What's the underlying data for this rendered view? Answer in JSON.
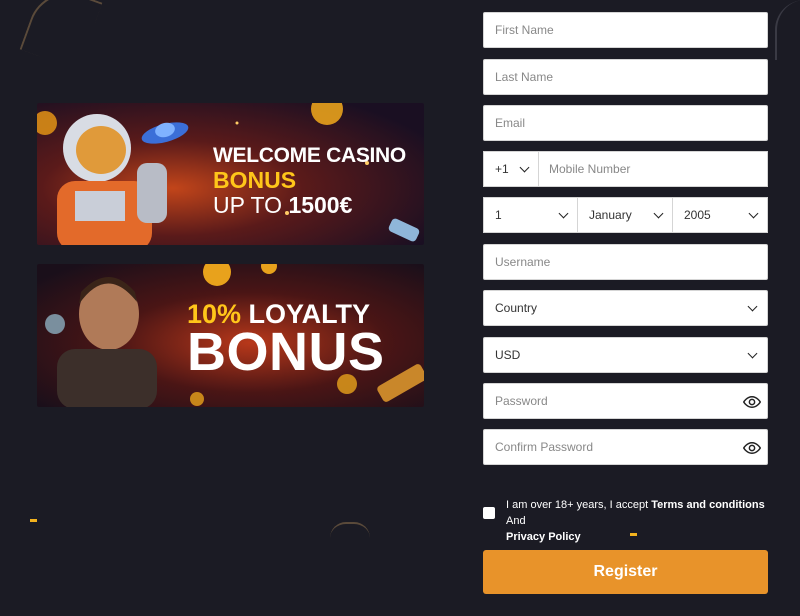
{
  "banners": {
    "welcome": {
      "line1": "WELCOME CASINO",
      "line2": "BONUS",
      "line3_prefix": "UP TO ",
      "line3_amount": "1500€"
    },
    "loyalty": {
      "percent": "10%",
      "line1_rest": " LOYALTY",
      "line2": "BONUS"
    }
  },
  "form": {
    "first_name": {
      "placeholder": "First Name"
    },
    "last_name": {
      "placeholder": "Last Name"
    },
    "email": {
      "placeholder": "Email"
    },
    "phone": {
      "code": "+1",
      "placeholder": "Mobile Number"
    },
    "dob": {
      "day": "1",
      "month": "January",
      "year": "2005"
    },
    "username": {
      "placeholder": "Username"
    },
    "country": {
      "value": "Country"
    },
    "currency": {
      "value": "USD"
    },
    "password": {
      "placeholder": "Password",
      "icon": "eye-icon"
    },
    "confirm_password": {
      "placeholder": "Confirm Password",
      "icon": "eye-icon"
    }
  },
  "consent": {
    "prefix": "I am over 18+ years, I accept ",
    "terms": "Terms and conditions",
    "and": " And ",
    "privacy": "Privacy Policy"
  },
  "register_button": "Register",
  "colors": {
    "background": "#1b1b24",
    "accent": "#e8932a",
    "highlight": "#ffc61a"
  }
}
